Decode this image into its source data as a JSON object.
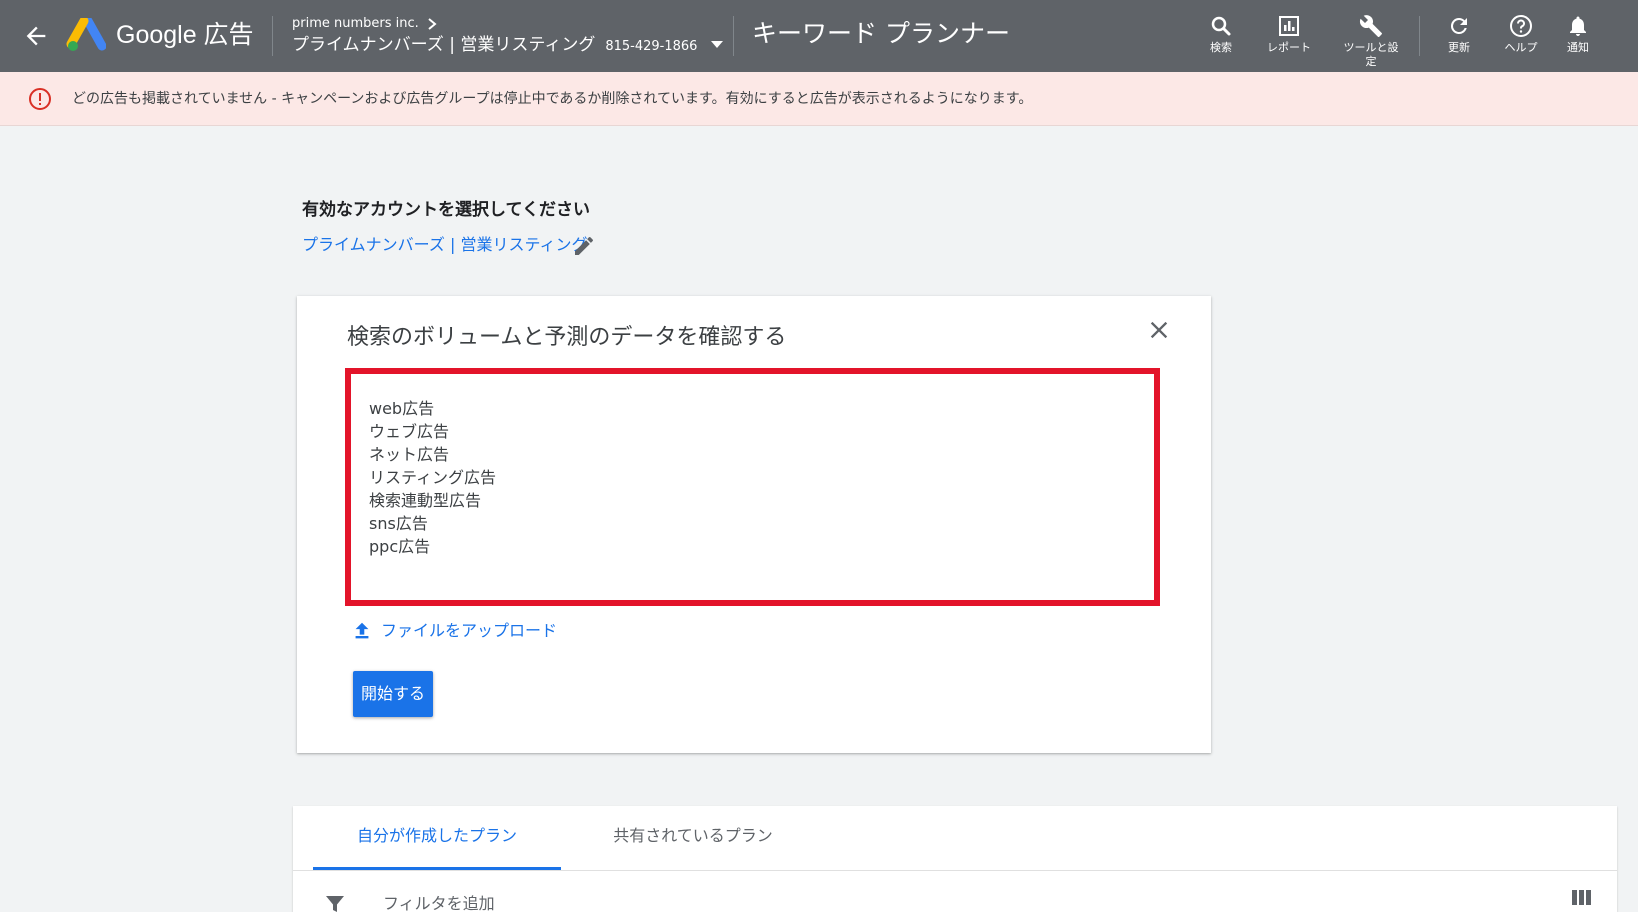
{
  "header": {
    "brand": "Google 広告",
    "account_company": "prime numbers inc.",
    "account_name": "プライムナンバーズ | 営業リスティング",
    "account_id": "815-429-1866",
    "page_title": "キーワード プランナー",
    "tools": [
      {
        "label": "検索",
        "icon": "search-icon"
      },
      {
        "label": "レポート",
        "icon": "reports-icon"
      },
      {
        "label": "ツールと設定",
        "icon": "wrench-icon"
      },
      {
        "label": "更新",
        "icon": "refresh-icon"
      },
      {
        "label": "ヘルプ",
        "icon": "help-icon"
      },
      {
        "label": "通知",
        "icon": "bell-icon"
      }
    ]
  },
  "banner": {
    "text": "どの広告も掲載されていません - キャンペーンおよび広告グループは停止中であるか削除されています。有効にすると広告が表示されるようになります。",
    "icon": "error-icon"
  },
  "account_select": {
    "title": "有効なアカウントを選択してください",
    "link": "プライムナンバーズ | 営業リスティング"
  },
  "card": {
    "title": "検索のボリュームと予測のデータを確認する",
    "keywords": [
      "web広告",
      "ウェブ広告",
      "ネット広告",
      "リスティング広告",
      "検索連動型広告",
      "sns広告",
      "ppc広告"
    ],
    "upload_label": "ファイルをアップロード",
    "start_label": "開始する"
  },
  "plans": {
    "tabs": [
      "自分が作成したプラン",
      "共有されているプラン"
    ],
    "filter_label": "フィルタを追加"
  },
  "colors": {
    "header_bg": "#5f6368",
    "banner_bg": "#fce8e6",
    "accent": "#1a73e8",
    "highlight_red": "#e3142a"
  }
}
